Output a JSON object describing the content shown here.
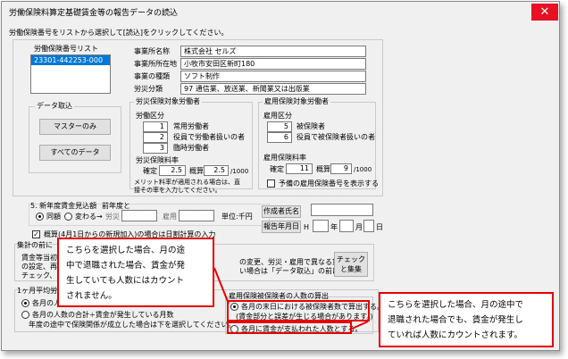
{
  "window": {
    "title": "労働保険料算定基礎賃金等の報告データの読込"
  },
  "instruction": "労働保険番号をリストから選択して[読込]をクリックしてください。",
  "list": {
    "label": "労働保険番号リスト",
    "items": [
      "23301-442253-000"
    ]
  },
  "office": {
    "name_label": "事業所名称",
    "name": "株式会社 セルズ",
    "address_label": "事業所所在地",
    "address": "小牧市安田区新町180",
    "type_label": "事業の種類",
    "type": "ソフト制作",
    "category_label": "労災分類",
    "category": "97 通信業、放送業、新聞業又は出版業"
  },
  "data_import": {
    "label": "データ取込",
    "master_button": "マスターのみ",
    "all_button": "すべてのデータ"
  },
  "rousai": {
    "label": "労災保険対象労働者",
    "worker_class": "労働区分",
    "rows": [
      {
        "num": "1",
        "label": "常用労働者"
      },
      {
        "num": "2",
        "label": "役員で労働者扱いの者"
      },
      {
        "num": "3",
        "label": "臨時労働者"
      }
    ],
    "rate_label": "労災保険料率",
    "kakutei_label": "確定",
    "kakutei": "2.5",
    "gaisan_label": "概算",
    "gaisan": "2.5",
    "per": "/1000",
    "note1": "メリット料率が適用される場合は、直",
    "note2": "接その率を入力してください。"
  },
  "koyou": {
    "label": "雇用保険対象労働者",
    "worker_class": "雇用区分",
    "rows": [
      {
        "num": "5",
        "label": "被保険者"
      },
      {
        "num": "6",
        "label": "役員で被保険者扱いの者"
      }
    ],
    "rate_label": "雇用保険料率",
    "kakutei_label": "確定",
    "kakutei": "11",
    "gaisan_label": "概算",
    "gaisan": "9",
    "per": "/1000",
    "checkbox_label": "予備の雇用保険番号を表示する"
  },
  "new_year": {
    "label": "5. 新年度賃金見込額",
    "prev_year": "前年度と",
    "same": "同額",
    "change": "変わる→",
    "rousai": "労災",
    "koyou": "雇用",
    "unit": "単位:千円"
  },
  "creator": {
    "name_label": "作成者氏名",
    "date_label": "報告年月日",
    "era": "H",
    "year": "年",
    "month": "月",
    "day": "日"
  },
  "gaisan_check": {
    "label": "概算(4月1日からの新規加入)の場合は日割計算の入力"
  },
  "shukei": {
    "label": "集計の前に",
    "line1": "賃金等当初",
    "line2": "の設定、再",
    "line3": "チェック、ま",
    "right1": "の変更、労災・雇用で異なる賃金",
    "right2": "い場合は「データ取込」の前に",
    "check_button_1": "チェック",
    "check_button_2": "と集集"
  },
  "monthly": {
    "label": "1ヶ月平均労",
    "opt1": "各月の人",
    "opt2": "各月の人数の合計÷賃金が発生している月数",
    "opt3": "年度の途中で保険関係が成立した場合は下を選択してください。"
  },
  "koyou_count": {
    "label": "雇用保険被保険者の人数の算出",
    "opt1": "各月の末日における被保険者数で算出する。",
    "opt1_sub": "(賃金部分と誤差が生じる場合があります。)",
    "opt2": "各月に賃金が支払われた人数とする。"
  },
  "callout_left": {
    "line1": "こちらを選択した場合、月の途",
    "line2": "中で退職された場合、賃金が発",
    "line3": "生していても人数にはカウント",
    "line4": "されません。"
  },
  "callout_right": {
    "line1": "こちらを選択した場合、月の途中で",
    "line2": "退職された場合でも、賃金が発生し",
    "line3": "ていれば人数にカウントされます。"
  },
  "colors": {
    "accent_red": "#e60000",
    "close_red": "#e81123",
    "selection_blue": "#0078d7"
  }
}
